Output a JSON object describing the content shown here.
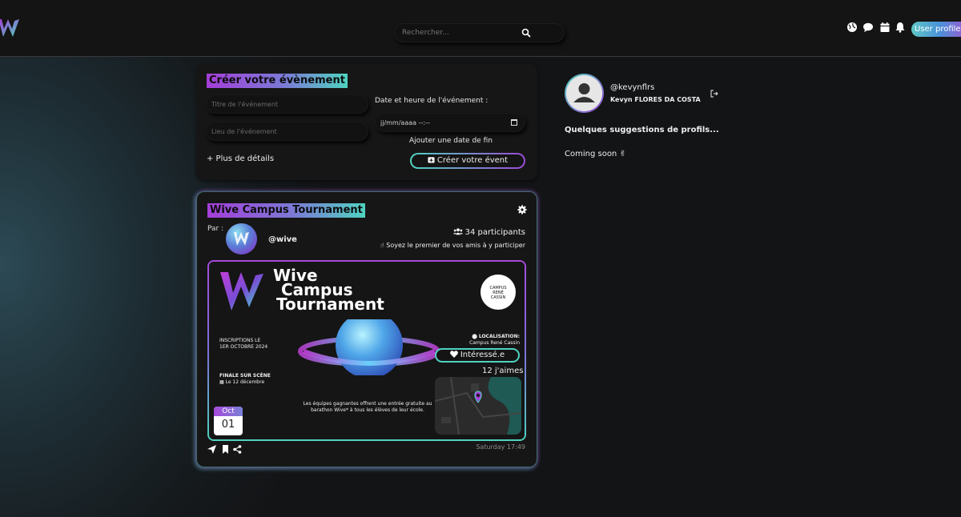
{
  "navbar": {
    "search_placeholder": "Rechercher...",
    "icons": [
      "globe-icon",
      "chat-icon",
      "calendar-icon",
      "bell-icon"
    ],
    "profile_alt": "User profile"
  },
  "create_event": {
    "title": "Créer votre évènement",
    "title_placeholder": "Titre de l'événement",
    "location_placeholder": "Lieu de l'événement",
    "datetime_label": "Date et heure de l'événement :",
    "datetime_value": "jj/mm/aaaa --:--",
    "add_end_date": "Ajouter une date de fin",
    "more_details": "+ Plus de détails",
    "submit_label": "Créer votre évent"
  },
  "event": {
    "title": "Wive Campus Tournament",
    "by_label": "Par :",
    "author": "@wive",
    "participants": "34 participants",
    "be_first": "☝ Soyez le premier de vos amis à y participer",
    "poster": {
      "title_line1": "Wive",
      "title_line2": "Campus",
      "title_line3": "Tournament",
      "school_top": "CAMPUS",
      "school_mid": "RENÉ",
      "school_bot": "CASSIN",
      "registration_line1": "INSCRIPTIONS LE",
      "registration_line2": "1ER OCTOBRE 2024",
      "final_label": "FINALE SUR SCÈNE",
      "final_date": "Le 12 décembre",
      "location_label": "LOCALISATION:",
      "location_value": "Campus René Cassin",
      "description": "Les équipes gagnantes offrent une entrée gratuite au barathon Wive* à tous les élèves de leur école.",
      "month": "Oct",
      "day": "01"
    },
    "interested_label": "Intéressé.e",
    "likes": "12 j'aimes",
    "timestamp": "Saturday 17:49"
  },
  "sidebar": {
    "username": "@kevynflrs",
    "fullname": "Kevyn FLORES DA COSTA",
    "suggestions_title": "Quelques suggestions de profils...",
    "coming_soon": "Coming soon ✌"
  },
  "colors": {
    "accent_purple": "#a43ed8",
    "accent_teal": "#4fd3c0",
    "card_bg": "#161616",
    "nav_bg": "#141414"
  }
}
